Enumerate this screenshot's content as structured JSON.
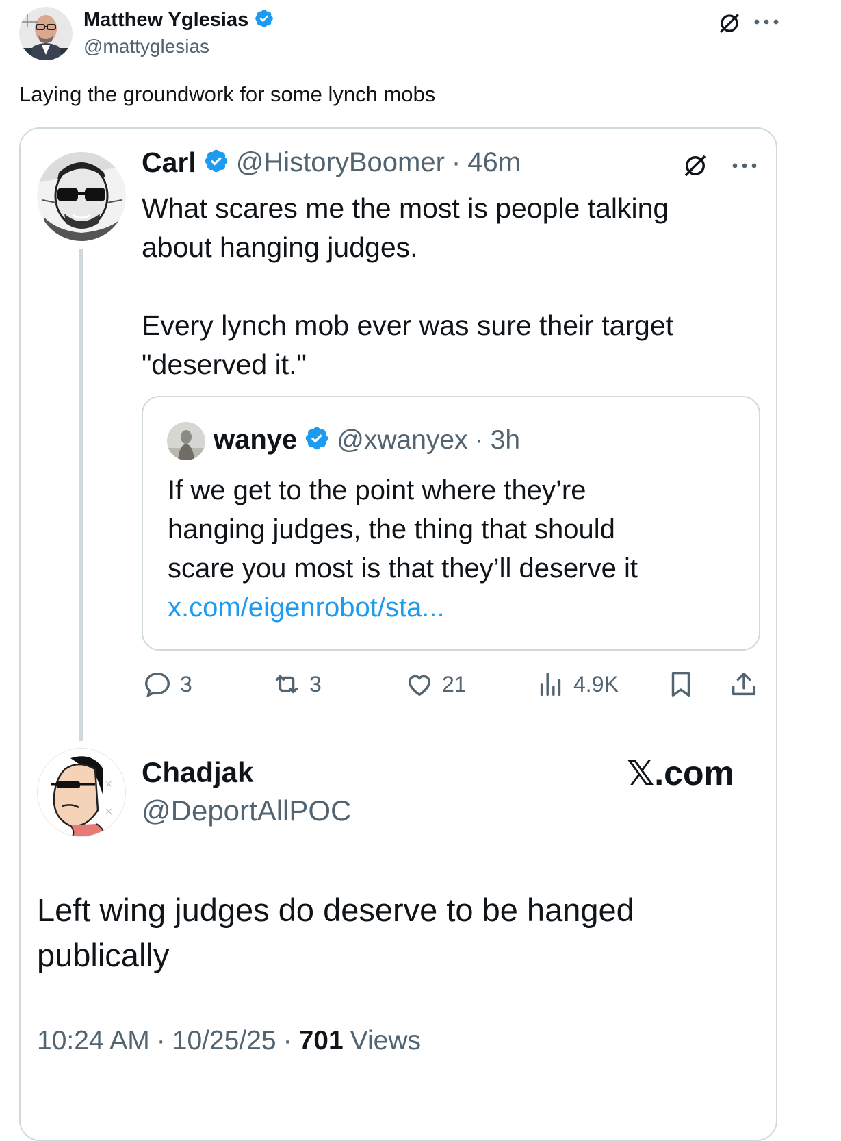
{
  "outer_post": {
    "author_name": "Matthew Yglesias",
    "handle": "@mattyglesias",
    "text": "Laying the groundwork for some lynch mobs"
  },
  "quoted_post": {
    "author_name": "Carl",
    "handle": "@HistoryBoomer",
    "separator": "·",
    "time": "46m",
    "text_line1": "What scares me the most is people talking",
    "text_line2": "about hanging judges.",
    "text_line3": "Every lynch mob ever was sure their target",
    "text_line4": "\"deserved it.\"",
    "metrics": {
      "replies": "3",
      "reposts": "3",
      "likes": "21",
      "views": "4.9K"
    }
  },
  "nested_quote": {
    "author_name": "wanye",
    "handle": "@xwanyex",
    "separator": "·",
    "time": "3h",
    "text_line1": "If we get to the point where they’re",
    "text_line2": "hanging judges, the thing that should",
    "text_line3": "scare you most is that they’ll deserve it",
    "link": "x.com/eigenrobot/sta..."
  },
  "reply_post": {
    "author_name": "Chadjak",
    "handle": "@DeportAllPOC",
    "brand": "𝕏.com",
    "text_line1": "Left wing judges do deserve to be hanged",
    "text_line2": "publically",
    "time": "10:24 AM",
    "separator": "·",
    "date": "10/25/25",
    "views_count": "701",
    "views_label": "Views"
  },
  "colors": {
    "verified": "#1d9bf0",
    "text": "#0f1419",
    "muted": "#536471",
    "border": "#cfd9de",
    "link": "#1d9bf0"
  },
  "icons": [
    "verified-badge-icon",
    "no-entry-icon",
    "more-icon",
    "reply-icon",
    "repost-icon",
    "like-icon",
    "views-icon",
    "bookmark-icon",
    "share-icon"
  ]
}
